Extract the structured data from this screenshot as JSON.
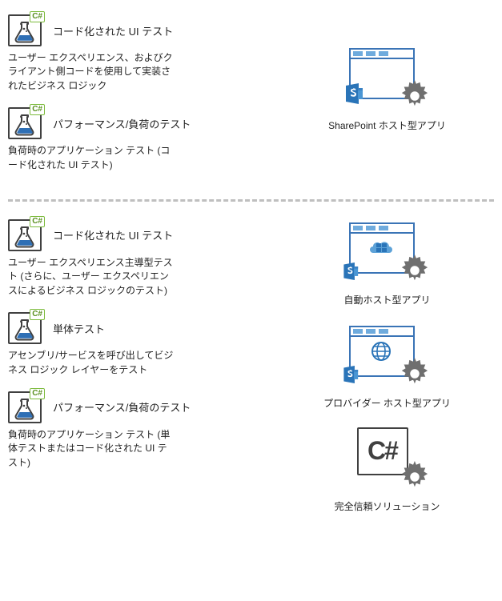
{
  "section_a": {
    "tests": [
      {
        "title": "コード化された UI テスト",
        "desc": "ユーザー エクスペリエンス、およびクライアント側コードを使用して実装されたビジネス ロジック",
        "icon_tag": "C#"
      },
      {
        "title": "パフォーマンス/負荷のテスト",
        "desc": "負荷時のアプリケーション テスト (コード化された UI テスト)",
        "icon_tag": "C#"
      }
    ],
    "apps": [
      {
        "caption": "SharePoint ホスト型アプリ"
      }
    ]
  },
  "section_b": {
    "tests": [
      {
        "title": "コード化された UI テスト",
        "desc": "ユーザー エクスペリエンス主導型テスト (さらに、ユーザー エクスペリエンスによるビジネス ロジックのテスト)",
        "icon_tag": "C#"
      },
      {
        "title": "単体テスト",
        "desc": "アセンブリ/サービスを呼び出してビジネス ロジック レイヤーをテスト",
        "icon_tag": "C#"
      },
      {
        "title": "パフォーマンス/負荷のテスト",
        "desc": "負荷時のアプリケーション テスト (単体テストまたはコード化された UI テスト)",
        "icon_tag": "C#"
      }
    ],
    "apps": [
      {
        "caption": "自動ホスト型アプリ"
      },
      {
        "caption": "プロバイダー ホスト型アプリ"
      },
      {
        "caption": "完全信頼ソリューション"
      }
    ]
  },
  "csharp_big_label": "C#"
}
